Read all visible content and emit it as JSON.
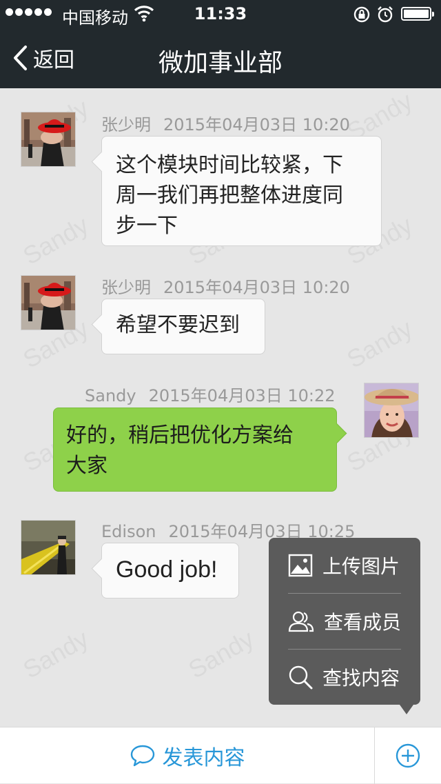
{
  "status_bar": {
    "carrier": "中国移动",
    "time": "11:33",
    "icons": [
      "signal-dots-icon",
      "wifi-icon",
      "rotation-lock-icon",
      "alarm-icon",
      "battery-icon"
    ]
  },
  "nav": {
    "back_label": "返回",
    "title": "微加事业部"
  },
  "watermark": "Sandy",
  "messages": [
    {
      "sender": "张少明",
      "time": "2015年04月03日 10:20",
      "text_lines": [
        "这个模块时间比较紧，下",
        "周一我们再把整体进度同",
        "步一下"
      ],
      "side": "left",
      "avatar": "red-hat-avatar"
    },
    {
      "sender": "张少明",
      "time": "2015年04月03日 10:20",
      "text_lines": [
        "希望不要迟到"
      ],
      "side": "left",
      "avatar": "red-hat-avatar"
    },
    {
      "sender": "Sandy",
      "time": "2015年04月03日 10:22",
      "text_lines": [
        "好的，稍后把优化方案给",
        "大家"
      ],
      "side": "right",
      "avatar": "straw-hat-avatar"
    },
    {
      "sender": "Edison",
      "time": "2015年04月03日 10:25",
      "text_lines": [
        "Good job!"
      ],
      "side": "left",
      "avatar": "fence-photo-avatar"
    }
  ],
  "popup_menu": {
    "items": [
      {
        "label": "上传图片",
        "icon": "image-icon"
      },
      {
        "label": "查看成员",
        "icon": "members-icon"
      },
      {
        "label": "查找内容",
        "icon": "search-icon"
      }
    ]
  },
  "bottom_bar": {
    "post_label": "发表内容",
    "accent_color": "#2897d8"
  }
}
